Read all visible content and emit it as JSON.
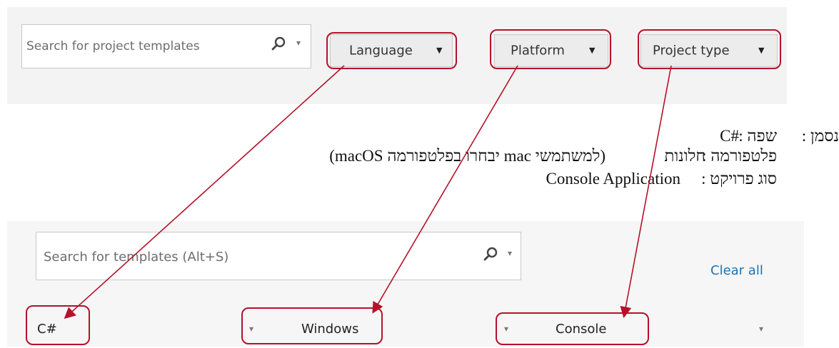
{
  "top": {
    "search_placeholder": "Search for project templates",
    "language_label": "Language",
    "platform_label": "Platform",
    "project_type_label": "Project type"
  },
  "instructions": {
    "lead": "נסמן :",
    "line1_key": "שפה :",
    "line1_val": "C#",
    "line2_key": "פלטפורמה :",
    "line2_val": "חלונות",
    "line2_note": "(למשתמשי mac יבחרו בפלטפורמה macOS)",
    "line3_key": "סוג פרויקט :",
    "line3_val": "Console Application"
  },
  "bottom": {
    "search_placeholder": "Search for templates (Alt+S)",
    "clear_all": "Clear all",
    "language_value": "C#",
    "platform_value": "Windows",
    "project_type_value": "Console"
  },
  "colors": {
    "annotation_red": "#b5122a",
    "link_blue": "#1a73b8"
  },
  "icons": [
    "search-icon",
    "chevron-down-icon",
    "arrow-icon"
  ]
}
